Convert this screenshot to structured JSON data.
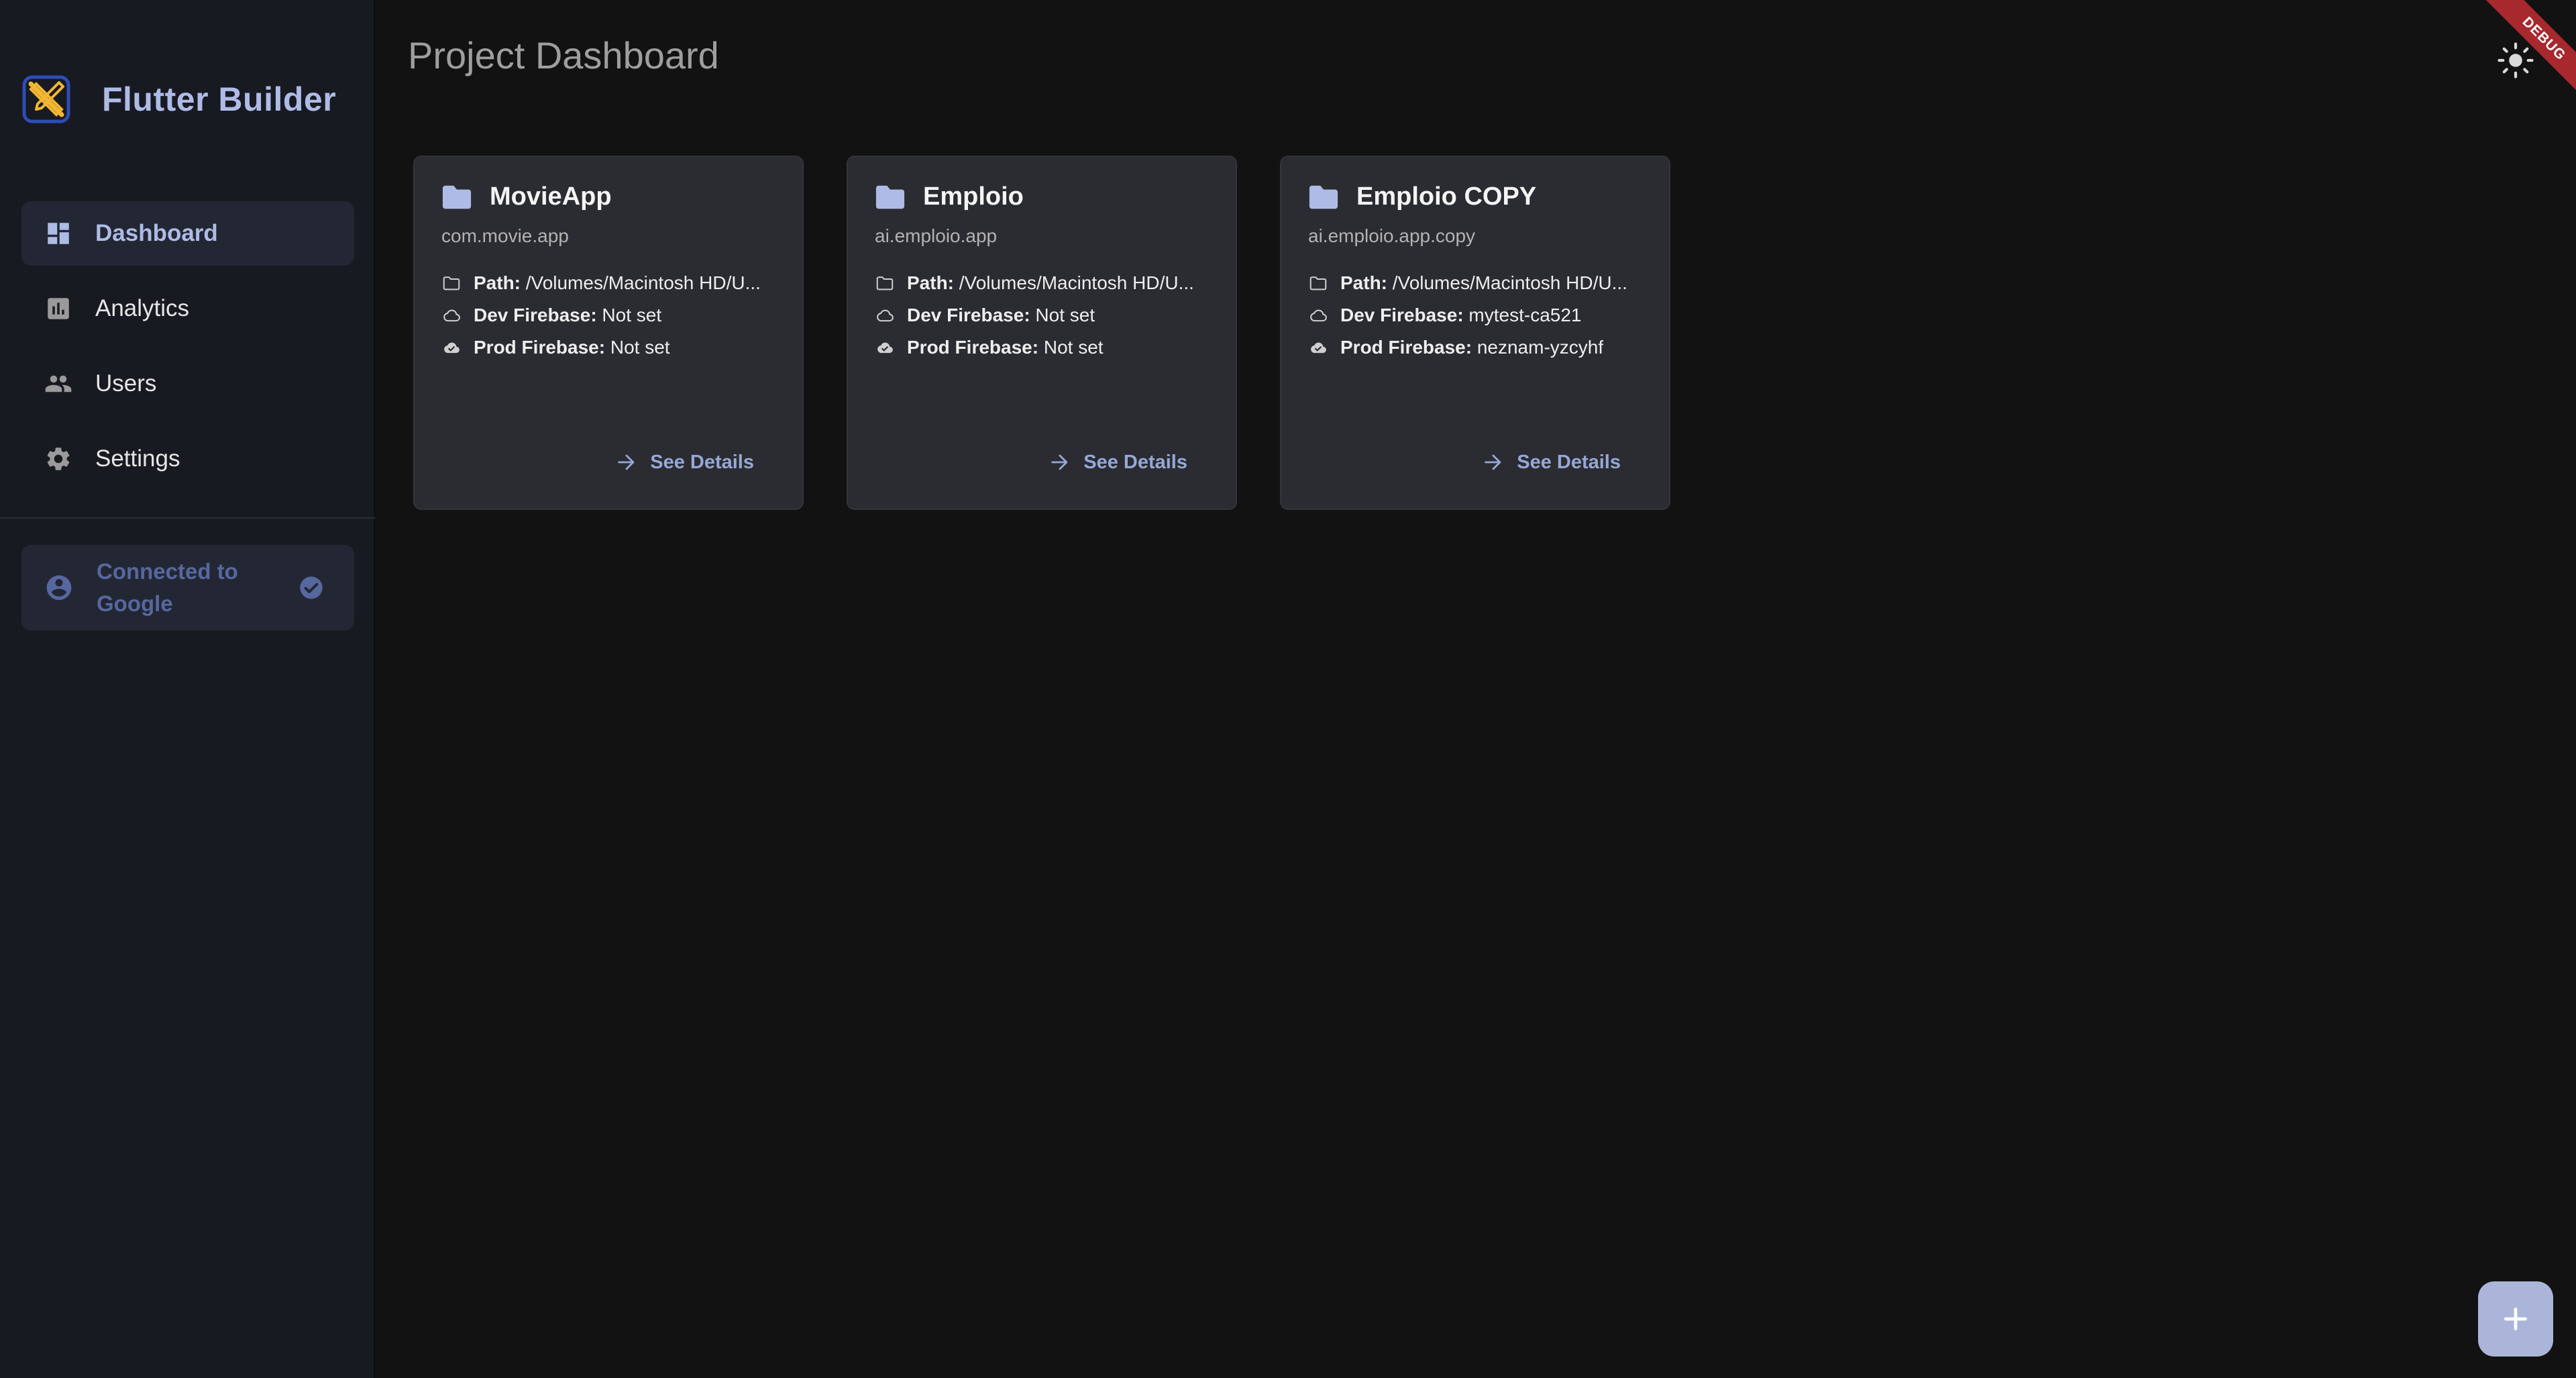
{
  "app": {
    "title": "Flutter Builder"
  },
  "sidebar": {
    "items": [
      {
        "label": "Dashboard",
        "icon": "dashboard-icon",
        "active": true
      },
      {
        "label": "Analytics",
        "icon": "analytics-icon",
        "active": false
      },
      {
        "label": "Users",
        "icon": "users-icon",
        "active": false
      },
      {
        "label": "Settings",
        "icon": "gear-icon",
        "active": false
      }
    ],
    "google_status": {
      "label": "Connected to Google",
      "icon": "account-circle-icon",
      "status_icon": "check-circle-icon"
    }
  },
  "header": {
    "title": "Project Dashboard",
    "theme_toggle_icon": "sun-icon",
    "debug_banner": "DEBUG"
  },
  "projects": [
    {
      "name": "MovieApp",
      "package": "com.movie.app",
      "path_label": "Path:",
      "path_value": " /Volumes/Macintosh HD/U...",
      "dev_label": "Dev Firebase:",
      "dev_value": " Not set",
      "prod_label": "Prod Firebase:",
      "prod_value": " Not set",
      "action": "See Details"
    },
    {
      "name": "Emploio",
      "package": "ai.emploio.app",
      "path_label": "Path:",
      "path_value": " /Volumes/Macintosh HD/U...",
      "dev_label": "Dev Firebase:",
      "dev_value": " Not set",
      "prod_label": "Prod Firebase:",
      "prod_value": " Not set",
      "action": "See Details"
    },
    {
      "name": "Emploio COPY",
      "package": "ai.emploio.app.copy",
      "path_label": "Path:",
      "path_value": " /Volumes/Macintosh HD/U...",
      "dev_label": "Dev Firebase:",
      "dev_value": " mytest-ca521",
      "prod_label": "Prod Firebase:",
      "prod_value": " neznam-yzcyhf",
      "action": "See Details"
    }
  ],
  "fab": {
    "icon": "plus-icon"
  },
  "colors": {
    "background": "#121212",
    "sidebar": "#181a21",
    "card": "#2b2c31",
    "accent": "#aebbe6",
    "link": "#97a7d7",
    "fab": "#aab5d9",
    "debug": "#a7282d"
  }
}
